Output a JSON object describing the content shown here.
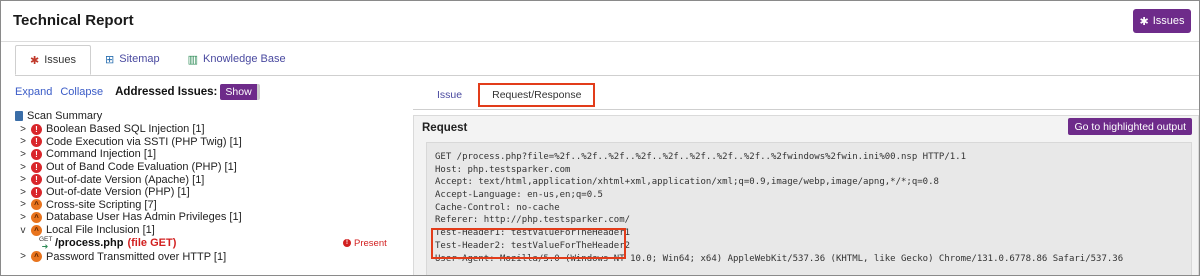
{
  "header": {
    "title": "Technical Report",
    "issues_button": "Issues",
    "issues_icon": "bug-icon"
  },
  "tabs": [
    {
      "label": "Issues",
      "icon": "bug-icon",
      "active": true
    },
    {
      "label": "Sitemap",
      "icon": "sitemap-icon",
      "active": false
    },
    {
      "label": "Knowledge Base",
      "icon": "book-icon",
      "active": false
    }
  ],
  "left": {
    "expand": "Expand",
    "collapse": "Collapse",
    "addressed_label": "Addressed Issues:",
    "show_button": "Show",
    "root": "Scan Summary",
    "items": [
      {
        "label": "Boolean Based SQL Injection [1]",
        "severity": "critical",
        "expanded": false
      },
      {
        "label": "Code Execution via SSTI (PHP Twig) [1]",
        "severity": "critical",
        "expanded": false
      },
      {
        "label": "Command Injection [1]",
        "severity": "critical",
        "expanded": false
      },
      {
        "label": "Out of Band Code Evaluation (PHP) [1]",
        "severity": "critical",
        "expanded": false
      },
      {
        "label": "Out-of-date Version (Apache) [1]",
        "severity": "critical",
        "expanded": false
      },
      {
        "label": "Out-of-date Version (PHP) [1]",
        "severity": "critical",
        "expanded": false
      },
      {
        "label": "Cross-site Scripting [7]",
        "severity": "high",
        "expanded": false
      },
      {
        "label": "Database User Has Admin Privileges [1]",
        "severity": "high",
        "expanded": false
      },
      {
        "label": "Local File Inclusion [1]",
        "severity": "high",
        "expanded": true
      },
      {
        "label": "Password Transmitted over HTTP [1]",
        "severity": "high",
        "expanded": false
      }
    ],
    "child": {
      "method": "GET",
      "path": "/process.php",
      "tag": "(file GET)",
      "status": "Present"
    }
  },
  "right": {
    "tabs": [
      {
        "label": "Issue",
        "active": false
      },
      {
        "label": "Request/Response",
        "active": true
      }
    ],
    "request_title": "Request",
    "goto_button": "Go to highlighted output",
    "lines": [
      "GET /process.php?file=%2f..%2f..%2f..%2f..%2f..%2f..%2f..%2f..%2fwindows%2fwin.ini%00.nsp HTTP/1.1",
      "Host: php.testsparker.com",
      "Accept: text/html,application/xhtml+xml,application/xml;q=0.9,image/webp,image/apng,*/*;q=0.8",
      "Accept-Language: en-us,en;q=0.5",
      "Cache-Control: no-cache",
      "Referer: http://php.testsparker.com/",
      "Test-Header1: testValueForTheHeader1",
      "Test-Header2: testValueForTheHeader2",
      "User-Agent: Mozilla/5.0 (Windows NT 10.0; Win64; x64) AppleWebKit/537.36 (KHTML, like Gecko) Chrome/131.0.6778.86 Safari/537.36"
    ]
  },
  "colors": {
    "accent": "#6e2b8a",
    "highlight": "#e23c1a",
    "critical": "#d9262b",
    "high": "#e8741e"
  }
}
